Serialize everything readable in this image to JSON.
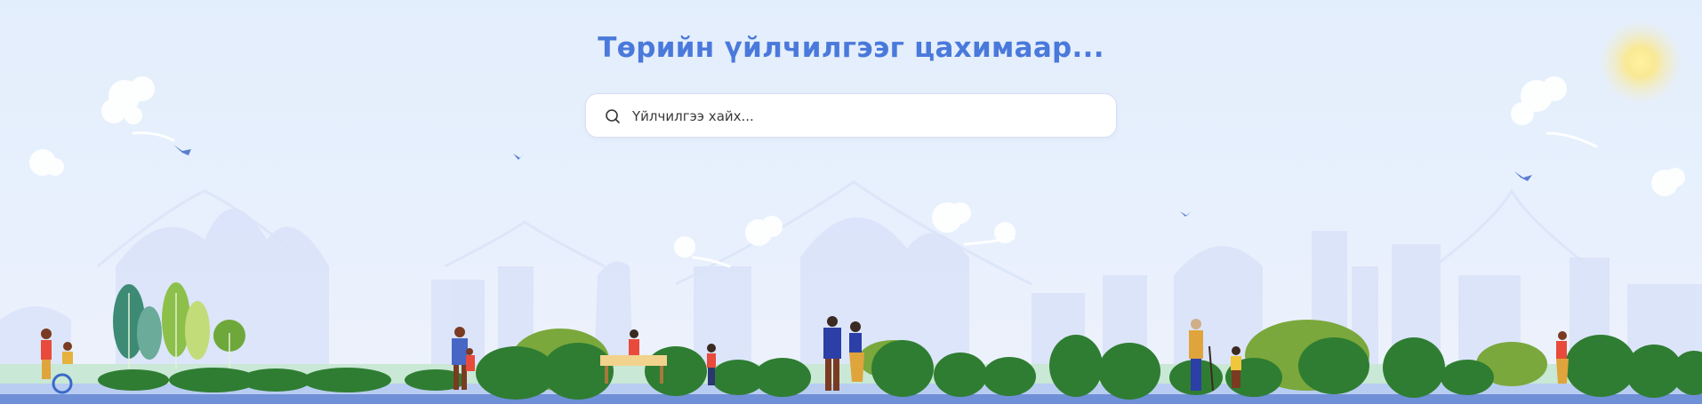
{
  "hero": {
    "title": "Төрийн үйлчилгээг цахимаар...",
    "search_placeholder": "Үйлчилгээ хайх..."
  },
  "colors": {
    "title": "#4a79dc",
    "sky": "#e3eefc",
    "bush_dark": "#2f7d32",
    "bush_light": "#7aa83c",
    "road": "#6f8fd6"
  },
  "icons": [
    "search-icon",
    "sun-icon",
    "cloud-icon",
    "bird-icon",
    "tree-icon"
  ]
}
